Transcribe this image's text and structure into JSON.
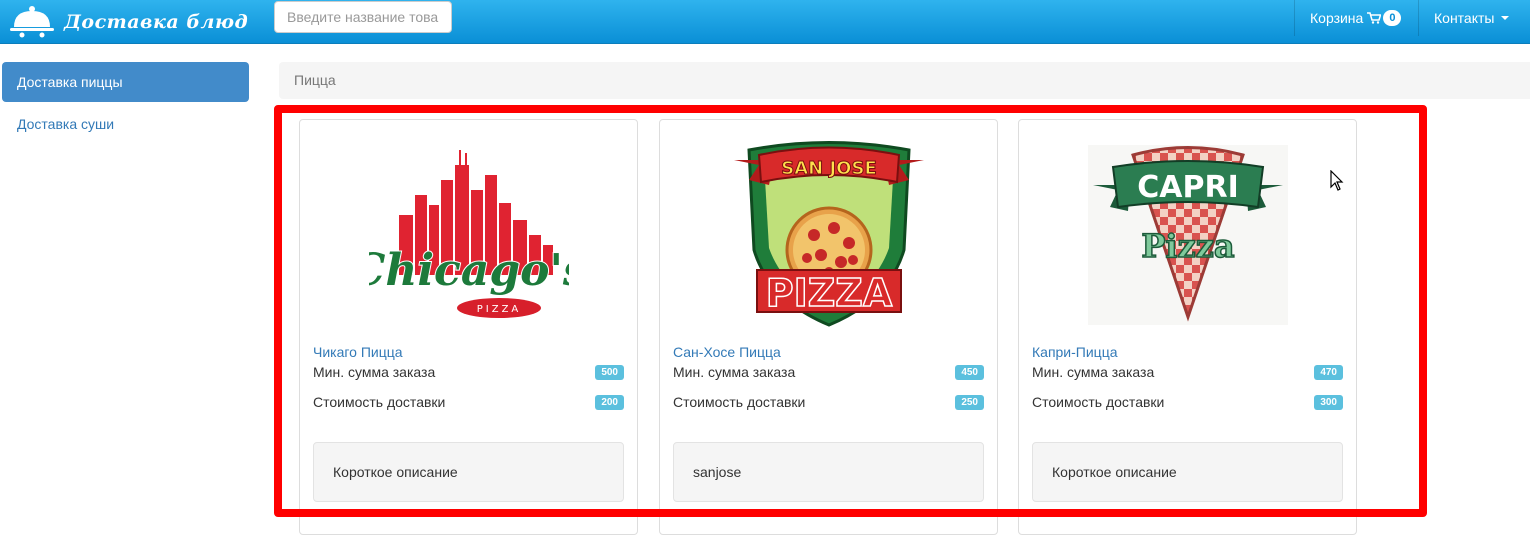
{
  "header": {
    "brand_title": "Доставка блюд",
    "search_placeholder": "Введите название това",
    "cart_label": "Корзина",
    "cart_count": "0",
    "contacts_label": "Контакты"
  },
  "sidebar": {
    "items": [
      {
        "label": "Доставка пиццы",
        "active": true
      },
      {
        "label": "Доставка суши",
        "active": false
      }
    ]
  },
  "breadcrumb": {
    "current": "Пицца"
  },
  "restaurants": [
    {
      "name": "Чикаго Пицца",
      "min_label": "Мин. сумма заказа",
      "min_value": "500",
      "delivery_label": "Стоимость доставки",
      "delivery_value": "200",
      "description": "Короткое описание",
      "logo": "chicagos-pizza-logo",
      "logo_text": "Chicago's",
      "logo_sub": "PIZZA"
    },
    {
      "name": "Сан-Хосе Пицца",
      "min_label": "Мин. сумма заказа",
      "min_value": "450",
      "delivery_label": "Стоимость доставки",
      "delivery_value": "250",
      "description": "sanjose",
      "logo": "san-jose-pizza-logo",
      "logo_text": "SAN JOSE",
      "logo_sub": "PIZZA"
    },
    {
      "name": "Капри-Пицца",
      "min_label": "Мин. сумма заказа",
      "min_value": "470",
      "delivery_label": "Стоимость доставки",
      "delivery_value": "300",
      "description": "Короткое описание",
      "logo": "capri-pizza-logo",
      "logo_text": "CAPRI",
      "logo_sub": "Pizza"
    }
  ],
  "colors": {
    "navbar_top": "#2fb3ee",
    "navbar_bottom": "#0a8fd6",
    "link": "#337ab7",
    "active": "#428bca",
    "badge": "#5bc0de",
    "highlight": "#ff0000"
  }
}
